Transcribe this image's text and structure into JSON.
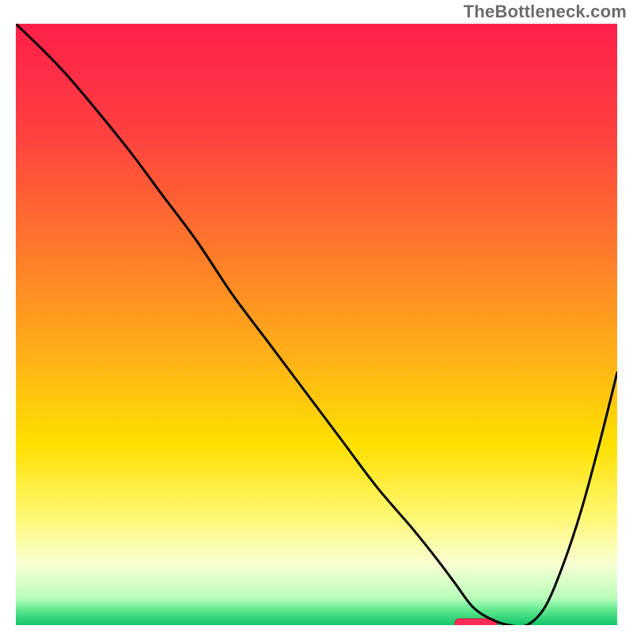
{
  "watermark": "TheBottleneck.com",
  "gradient": {
    "stops": [
      {
        "offset": 0.0,
        "color": "#ff1f4a"
      },
      {
        "offset": 0.18,
        "color": "#ff4040"
      },
      {
        "offset": 0.38,
        "color": "#ff7a2a"
      },
      {
        "offset": 0.55,
        "color": "#ffb018"
      },
      {
        "offset": 0.7,
        "color": "#ffe000"
      },
      {
        "offset": 0.82,
        "color": "#fff873"
      },
      {
        "offset": 0.9,
        "color": "#f7ffd4"
      },
      {
        "offset": 0.955,
        "color": "#b9ffb9"
      },
      {
        "offset": 0.975,
        "color": "#5fe88f"
      },
      {
        "offset": 1.0,
        "color": "#11c46a"
      }
    ]
  },
  "chart_data": {
    "type": "line",
    "title": "",
    "xlabel": "",
    "ylabel": "",
    "xlim": [
      0,
      100
    ],
    "ylim": [
      0,
      100
    ],
    "legend": null,
    "series": [
      {
        "name": "curve",
        "x": [
          0,
          8,
          18,
          24,
          30,
          36,
          42,
          48,
          54,
          60,
          66,
          70,
          73,
          76,
          79,
          82,
          85,
          88,
          91,
          94,
          97,
          100
        ],
        "y": [
          100,
          92,
          80,
          72,
          64,
          55,
          47,
          39,
          31,
          23,
          16,
          11,
          7,
          3,
          1,
          0,
          0,
          3,
          10,
          19,
          30,
          42
        ]
      }
    ],
    "marker": {
      "x_start": 73,
      "x_end": 80,
      "y": 0
    }
  }
}
